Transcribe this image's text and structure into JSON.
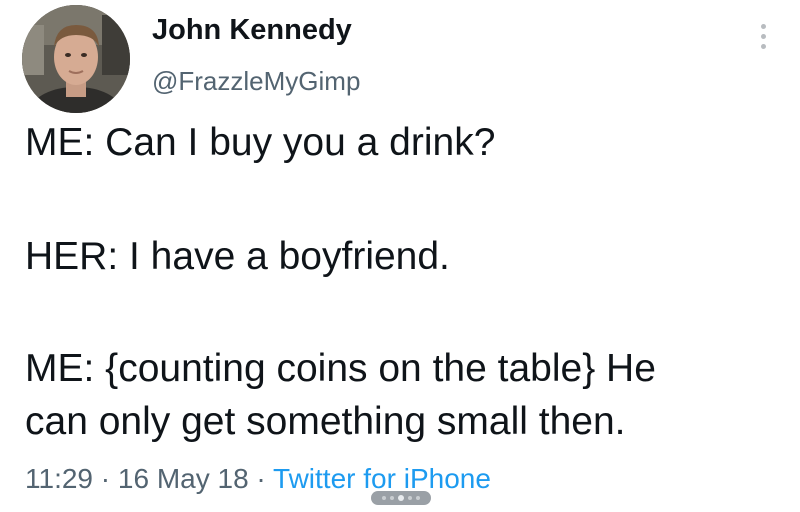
{
  "author": {
    "display_name": "John Kennedy",
    "handle": "@FrazzleMyGimp",
    "avatar_icon": "profile-photo"
  },
  "more_icon": "vertical-ellipsis-icon",
  "tweet": {
    "line1": "ME: Can I buy you a drink?",
    "line2": "HER: I have a boyfriend.",
    "line3": "ME: {counting coins on the table} He",
    "line4": "can only get something small then."
  },
  "meta": {
    "time": "11:29",
    "separator1": " · ",
    "date": "16 May 18",
    "separator2": " · ",
    "source": "Twitter for iPhone"
  },
  "colors": {
    "text": "#0f1419",
    "secondary": "#536471",
    "link": "#1d9bf0"
  }
}
